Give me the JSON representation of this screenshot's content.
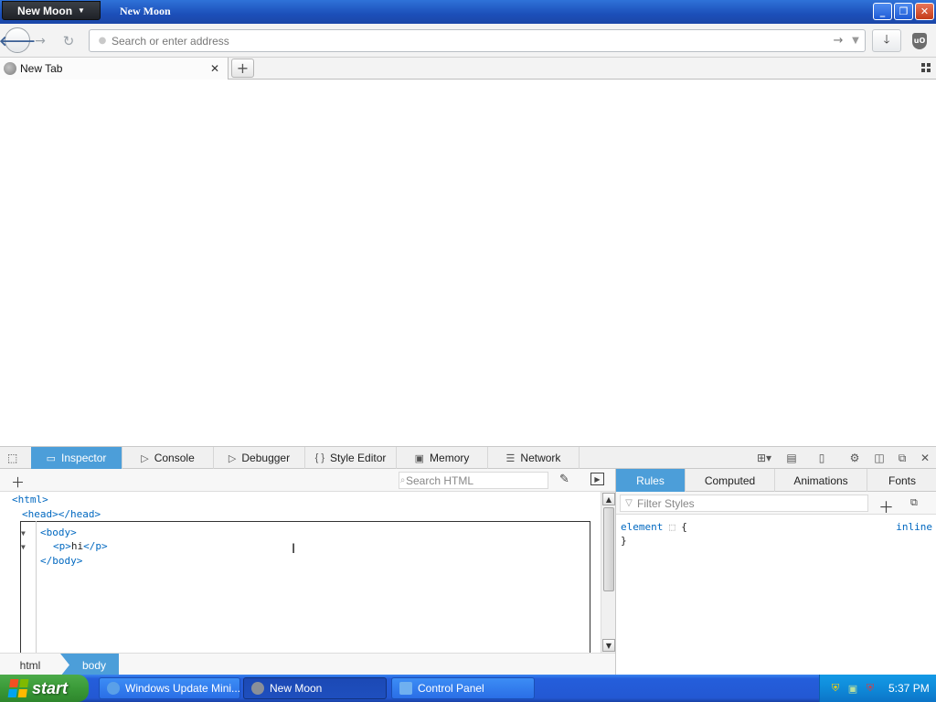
{
  "window": {
    "app_menu_label": "New Moon",
    "app_menu_arrow": "▼",
    "title": "New Moon",
    "minimize": "_",
    "restore": "❐",
    "close": "✕"
  },
  "navbar": {
    "back": "🡐",
    "forward": "→",
    "reload": "↻",
    "url_placeholder": "Search or enter address",
    "go": "→",
    "dropdown": "▼",
    "download": "🡓",
    "ublock": "uO"
  },
  "tabs": [
    {
      "label": "New Tab",
      "close": "✕"
    }
  ],
  "new_tab": "+",
  "devtools": {
    "tabs": [
      {
        "label": "Inspector",
        "icon": "▭"
      },
      {
        "label": "Console",
        "icon": "▷"
      },
      {
        "label": "Debugger",
        "icon": "▷"
      },
      {
        "label": "Style Editor",
        "icon": "{ }"
      },
      {
        "label": "Memory",
        "icon": "▣"
      },
      {
        "label": "Network",
        "icon": "☰"
      }
    ],
    "active_tab": "Inspector",
    "accent_color": "#4c9ed9",
    "search_html_placeholder": "Search HTML",
    "markup": {
      "html_open": "<html>",
      "head": "<head></head>",
      "body_open": "<body>",
      "p_open": "<p>",
      "p_text": "hi",
      "p_close": "</p>",
      "body_close": "</body>"
    },
    "breadcrumbs": [
      "html",
      "body"
    ],
    "side_tabs": [
      "Rules",
      "Computed",
      "Animations",
      "Fonts"
    ],
    "active_side_tab": "Rules",
    "filter_styles_placeholder": "Filter Styles",
    "rule": {
      "selector": "element",
      "open_brace": "{",
      "close_brace": "}",
      "source": "inline"
    }
  },
  "taskbar": {
    "start_label": "start",
    "tasks": [
      {
        "label": "Windows Update Mini...",
        "icon_color": "#5aa0e8"
      },
      {
        "label": "New Moon",
        "icon_color": "#8a8f99"
      },
      {
        "label": "Control Panel",
        "icon_color": "#6fb0f0"
      }
    ],
    "active_task": "New Moon",
    "clock": "5:37 PM"
  }
}
